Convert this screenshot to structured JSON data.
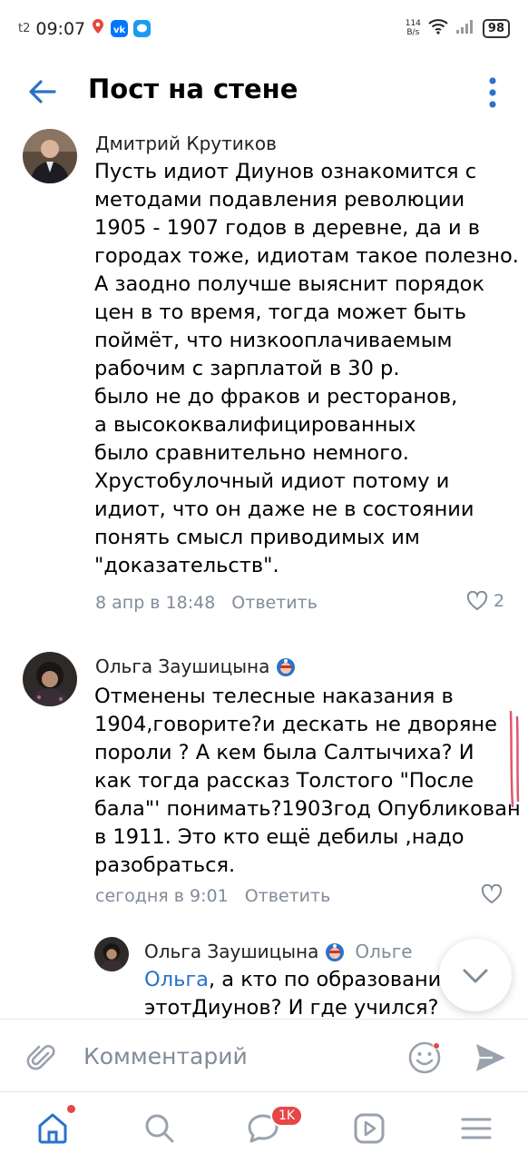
{
  "status_bar": {
    "carrier": "t2",
    "time": "09:07",
    "net_speed_value": "114",
    "net_speed_unit": "B/s",
    "battery": "98"
  },
  "header": {
    "title": "Пост на стене"
  },
  "comments": [
    {
      "author": "Дмитрий Крутиков",
      "text": "Пусть идиот Диунов ознакомится с\nметодами подавления революции\n1905 - 1907 годов в деревне, да и в\nгородах тоже, идиотам такое полезно.\nА заодно получше выяснит порядок\nцен в то время, тогда может быть\nпоймёт, что низкооплачиваемым\nрабочим с зарплатой в 30 р.\nбыло не до фраков и ресторанов,\nа высококвалифицированных\nбыло сравнительно немного.\nХрустобулочный идиот потому и\nидиот, что он даже не в состоянии\nпонять смысл приводимых им\n\"доказательств\".",
      "date": "8 апр в 18:48",
      "reply_label": "Ответить",
      "likes": "2"
    },
    {
      "author": "Ольга Заушицына",
      "text": "Отменены телесные наказания в\n1904,говорите?и дескать не дворяне\nпороли ? А кем была Салтычиха?  И\nкак тогда рассказ Толстого \"После\nбала\"' понимать?1903год Опубликован\nв 1911.  Это кто ещё дебилы ,надо\nразобраться.",
      "date": "сегодня в 9:01",
      "reply_label": "Ответить"
    },
    {
      "author": "Ольга Заушицына",
      "reply_to": "Ольге",
      "mention": "Ольга",
      "text_line1": ", а кто по образованию",
      "text_line2": "этотДиунов? И где учился? В"
    }
  ],
  "input": {
    "placeholder": "Комментарий"
  },
  "nav": {
    "messages_badge": "1K"
  },
  "colors": {
    "accent": "#2a72c9",
    "meta": "#818c99",
    "badge": "#e64646"
  }
}
